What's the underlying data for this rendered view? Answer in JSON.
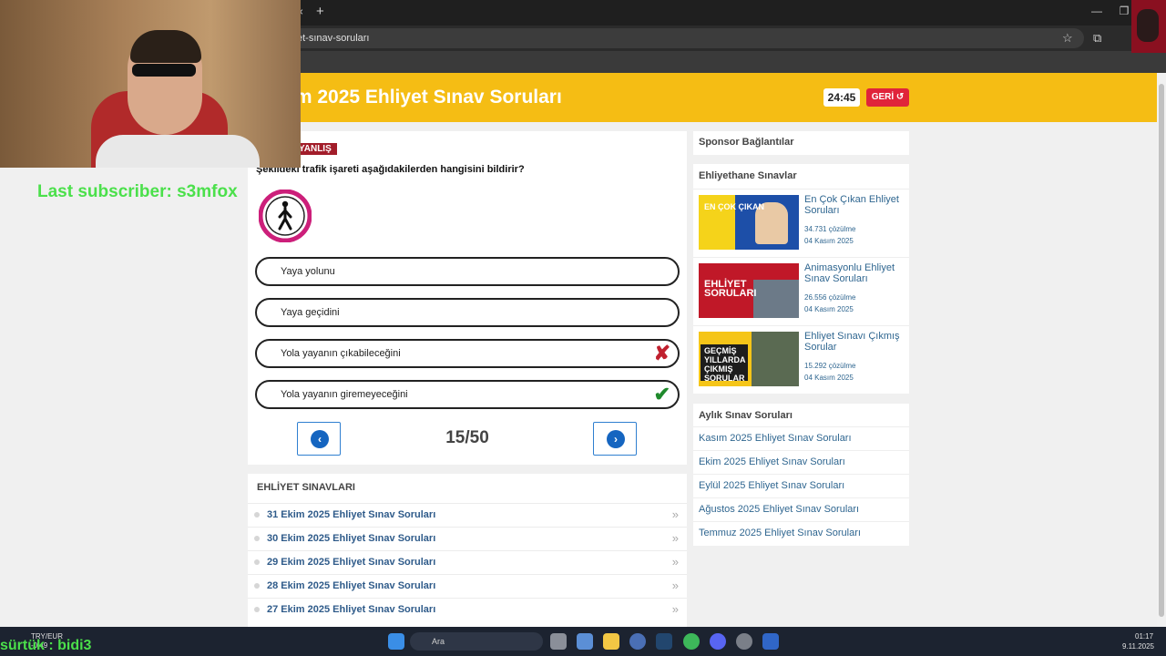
{
  "browser": {
    "url": "ekim-2025-ehliyet-sinav-sorulari",
    "url_visible": "et-sınav-soruları",
    "tab_close": "×",
    "new_tab": "+",
    "star": "☆",
    "ext": "⧉",
    "minimize": "—",
    "maximize": "❐"
  },
  "header": {
    "title": "im 2025 Ehliyet Sınav Soruları",
    "timer": "24:45",
    "back_label": "GERİ ↺"
  },
  "question": {
    "result": "YANLIŞ",
    "text": "Şekildeki trafik işareti aşağıdakilerden hangisini bildirir?",
    "answers": [
      {
        "label": "Yaya yolunu",
        "mark": ""
      },
      {
        "label": "Yaya geçidini",
        "mark": ""
      },
      {
        "label": "Yola yayanın çıkabileceğini",
        "mark": "✘"
      },
      {
        "label": "Yola yayanın giremeyeceğini",
        "mark": "✔"
      }
    ],
    "counter": "15/50",
    "prev_icon": "‹",
    "next_icon": "›"
  },
  "exams": {
    "title": "EHLİYET SINAVLARI",
    "items": [
      "31 Ekim 2025 Ehliyet Sınav Soruları",
      "30 Ekim 2025 Ehliyet Sınav Soruları",
      "29 Ekim 2025 Ehliyet Sınav Soruları",
      "28 Ekim 2025 Ehliyet Sınav Soruları",
      "27 Ekim 2025 Ehliyet Sınav Soruları"
    ],
    "chevron": "»"
  },
  "sidebar": {
    "sponsor_title": "Sponsor Bağlantılar",
    "tests_title": "Ehliyethane Sınavlar",
    "cards": [
      {
        "title": "En Çok Çıkan Ehliyet Soruları",
        "solves": "34.731 çözülme",
        "date": "04 Kasım 2025",
        "thumb_text": "EN ÇOK ÇIKAN"
      },
      {
        "title": "Animasyonlu Ehliyet Sınav Soruları",
        "solves": "26.556 çözülme",
        "date": "04 Kasım 2025",
        "thumb_text": "EHLİYET SORULARI"
      },
      {
        "title": "Ehliyet Sınavı Çıkmış Sorular",
        "solves": "15.292 çözülme",
        "date": "04 Kasım 2025",
        "thumb_text": "GEÇMİŞ YILLARDA ÇIKMIŞ SORULAR"
      }
    ],
    "monthly_title": "Aylık Sınav Soruları",
    "monthly": [
      "Kasım 2025 Ehliyet Sınav Soruları",
      "Ekim 2025 Ehliyet Sınav Soruları",
      "Eylül 2025 Ehliyet Sınav Soruları",
      "Ağustos 2025 Ehliyet Sınav Soruları",
      "Temmuz 2025 Ehliyet Sınav Soruları"
    ]
  },
  "overlay": {
    "subscriber": "Last subscriber: s3mfox",
    "stream_name": "sürtük : bidi3"
  },
  "taskbar": {
    "currency": "TRY/EUR",
    "currency_val": "-0,49",
    "search": "Ara",
    "time": "01:17",
    "date": "9.11.2025"
  },
  "colors": {
    "header_yellow": "#f5bd14",
    "wrong_red": "#a21d2a",
    "link_blue": "#2f6690"
  }
}
